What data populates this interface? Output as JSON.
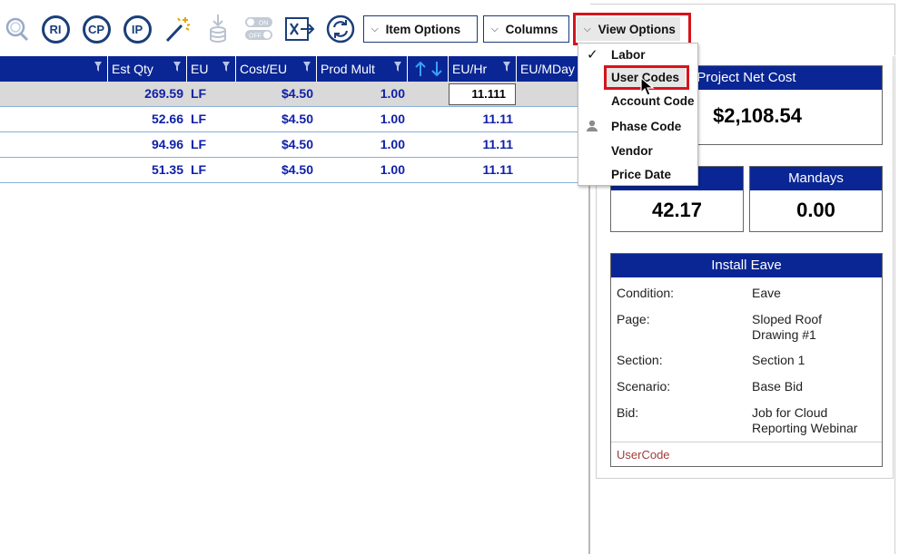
{
  "toolbar": {
    "icons": [
      "search-icon",
      "ri-icon",
      "cp-icon",
      "ip-icon",
      "magic-wand-icon",
      "download-database-icon",
      "toggle-on-off-icon",
      "export-x-icon",
      "refresh-icon"
    ],
    "ri_label": "RI",
    "cp_label": "CP",
    "ip_label": "IP",
    "toggle_on": "ON",
    "toggle_off": "OFF",
    "item_options_label": "Item Options",
    "columns_label": "Columns",
    "view_options_label": "View Options"
  },
  "grid": {
    "columns": [
      "Est Qty",
      "EU",
      "Cost/EU",
      "Prod Mult",
      "EU/Hr",
      "EU/MDay"
    ],
    "rows": [
      {
        "est_qty": "269.59",
        "eu": "LF",
        "cost_eu": "$4.50",
        "prod_mult": "1.00",
        "eu_hr": "11.111"
      },
      {
        "est_qty": "52.66",
        "eu": "LF",
        "cost_eu": "$4.50",
        "prod_mult": "1.00",
        "eu_hr": "11.11"
      },
      {
        "est_qty": "94.96",
        "eu": "LF",
        "cost_eu": "$4.50",
        "prod_mult": "1.00",
        "eu_hr": "11.11"
      },
      {
        "est_qty": "51.35",
        "eu": "LF",
        "cost_eu": "$4.50",
        "prod_mult": "1.00",
        "eu_hr": "11.11"
      }
    ]
  },
  "view_options_menu": {
    "items": [
      "Labor",
      "User Codes",
      "Account Code",
      "Phase Code",
      "Vendor",
      "Price Date"
    ],
    "checked": "Labor",
    "hovered": "User Codes"
  },
  "right_panel": {
    "project_net_cost_label": "Project Net Cost",
    "project_net_cost_value": "$2,108.54",
    "hours_value": "42.17",
    "mandays_label": "Mandays",
    "mandays_value": "0.00",
    "item_title": "Install Eave",
    "details": [
      {
        "label": "Condition:",
        "value": "Eave"
      },
      {
        "label": "Page:",
        "value": "Sloped Roof Drawing #1"
      },
      {
        "label": "Section:",
        "value": "Section 1"
      },
      {
        "label": "Scenario:",
        "value": "Base Bid"
      },
      {
        "label": "Bid:",
        "value": "Job for Cloud Reporting Webinar"
      }
    ],
    "user_code_label": "UserCode"
  },
  "colors": {
    "header_blue": "#0a2694",
    "value_blue": "#1020a8",
    "highlight_red": "#d6141b",
    "icon_navy": "#1a3f7a"
  }
}
